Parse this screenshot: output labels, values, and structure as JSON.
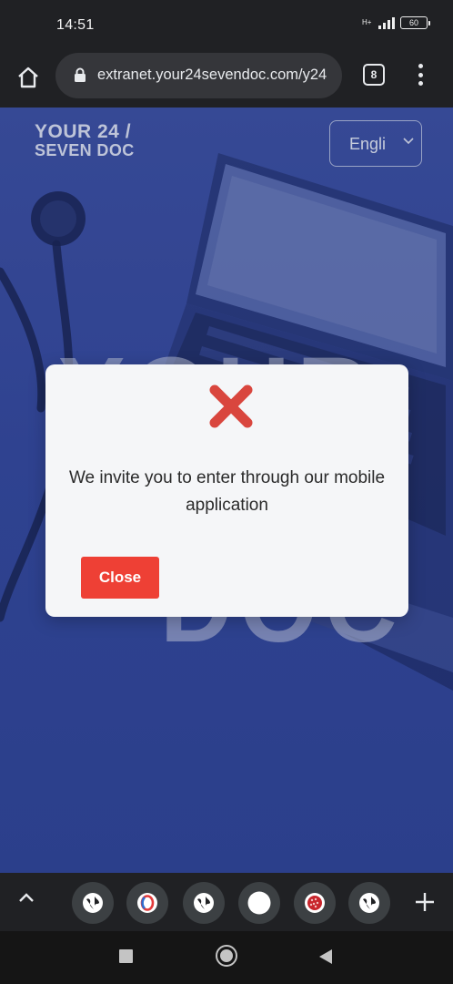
{
  "status_bar": {
    "time": "14:51",
    "network": "H+",
    "battery": "60"
  },
  "browser": {
    "url": "extranet.your24sevendoc.com/y24",
    "tab_count": "8"
  },
  "page": {
    "brand_line1": "YOUR 24 /",
    "brand_line2": "SEVEN DOC",
    "language_value": "Engli",
    "hero_text_top": "YOUR",
    "hero_text_bottom": "DOC"
  },
  "modal": {
    "message": "We invite you to enter through our mobile application",
    "close_label": "Close"
  },
  "colors": {
    "accent_red": "#ee4035",
    "page_blue": "#3c4fa0",
    "chrome_dark": "#202124"
  },
  "tab_strip": {
    "tabs": [
      "globe-icon",
      "opera-icon",
      "globe-icon",
      "blank-circle-icon",
      "red-ball-icon",
      "globe-icon"
    ]
  }
}
